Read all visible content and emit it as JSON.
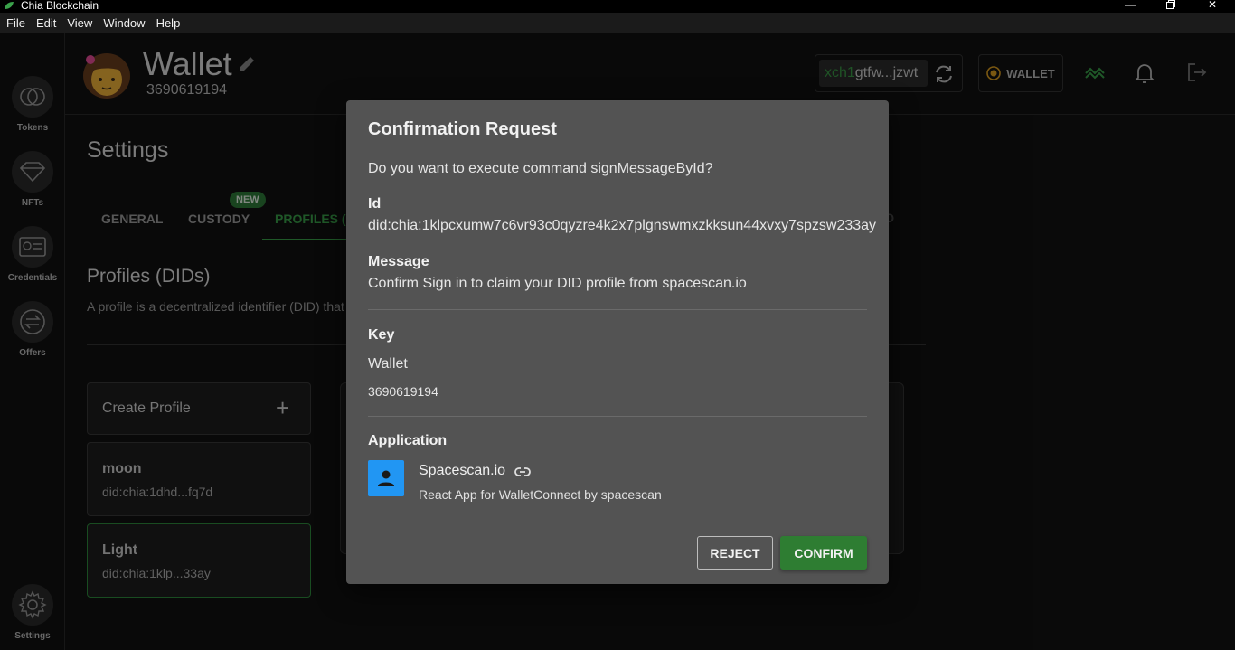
{
  "window": {
    "title": "Chia Blockchain",
    "controls": [
      "minimize",
      "maximize",
      "close"
    ]
  },
  "menu": [
    "File",
    "Edit",
    "View",
    "Window",
    "Help"
  ],
  "sidebar": {
    "items": [
      {
        "label": "Tokens",
        "icon": "tokens-icon"
      },
      {
        "label": "NFTs",
        "icon": "diamond-icon"
      },
      {
        "label": "Credentials",
        "icon": "id-card-icon"
      },
      {
        "label": "Offers",
        "icon": "swap-icon"
      },
      {
        "label": "Settings",
        "icon": "gear-icon"
      }
    ]
  },
  "header": {
    "title": "Wallet",
    "fingerprint": "3690619194",
    "address_prefix": "xch1",
    "address_rest": "gtfw...jzwt",
    "wallet_button": "WALLET"
  },
  "settings": {
    "title": "Settings",
    "tabs": [
      {
        "label": "GENERAL",
        "active": false
      },
      {
        "label": "CUSTODY",
        "active": false
      },
      {
        "label": "PROFILES (",
        "active": true
      }
    ],
    "new_badge": "NEW",
    "stray_letter": "D"
  },
  "profiles": {
    "title": "Profiles (DIDs)",
    "description": "A profile is a decentralized identifier (DID) that",
    "create_label": "Create Profile",
    "items": [
      {
        "name": "moon",
        "did": "did:chia:1dhd...fq7d",
        "selected": false
      },
      {
        "name": "Light",
        "did": "did:chia:1klp...33ay",
        "selected": true
      }
    ]
  },
  "dialog": {
    "title": "Confirmation Request",
    "question": "Do you want to execute command signMessageById?",
    "id_label": "Id",
    "id_value": "did:chia:1klpcxumw7c6vr93c0qyzre4k2x7plgnswmxzkksun44xvxy7spzsw233ay",
    "message_label": "Message",
    "message_value": "Confirm Sign in to claim your DID profile from spacescan.io",
    "key_label": "Key",
    "key_name": "Wallet",
    "key_fingerprint": "3690619194",
    "application_label": "Application",
    "app_name": "Spacescan.io",
    "app_description": "React App for WalletConnect by spacescan",
    "reject_label": "REJECT",
    "confirm_label": "CONFIRM"
  },
  "colors": {
    "accent_green": "#3aa14a",
    "confirm_green": "#2e7d32",
    "app_avatar_blue": "#2196f3",
    "dialog_bg": "#535353"
  }
}
